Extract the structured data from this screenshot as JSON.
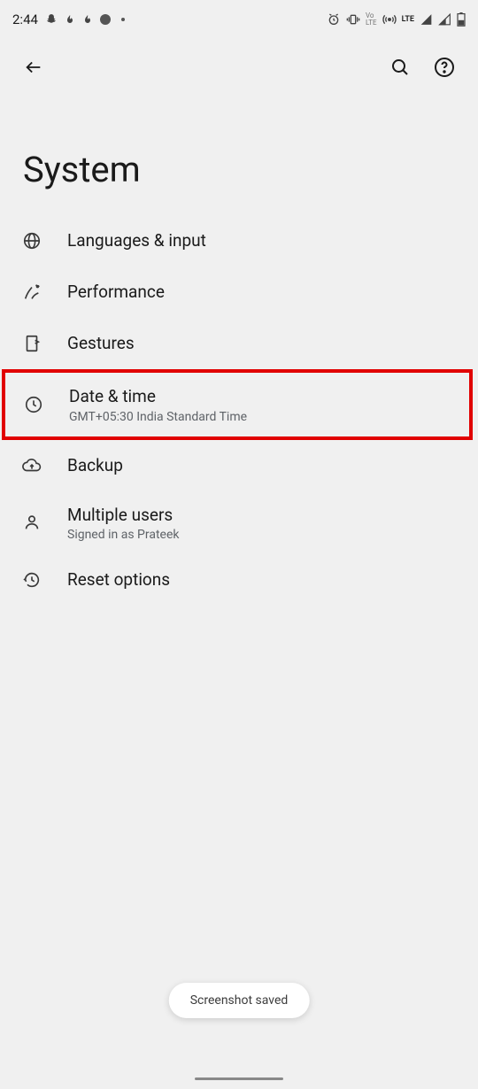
{
  "status_bar": {
    "time": "2:44",
    "lte_label": "LTE",
    "vo_label": "Vo\nLTE"
  },
  "toolbar": {},
  "page_title": "System",
  "items": [
    {
      "label": "Languages & input",
      "sub": null
    },
    {
      "label": "Performance",
      "sub": null
    },
    {
      "label": "Gestures",
      "sub": null
    },
    {
      "label": "Date & time",
      "sub": "GMT+05:30 India Standard Time"
    },
    {
      "label": "Backup",
      "sub": null
    },
    {
      "label": "Multiple users",
      "sub": "Signed in as Prateek"
    },
    {
      "label": "Reset options",
      "sub": null
    }
  ],
  "toast": {
    "message": "Screenshot saved"
  }
}
